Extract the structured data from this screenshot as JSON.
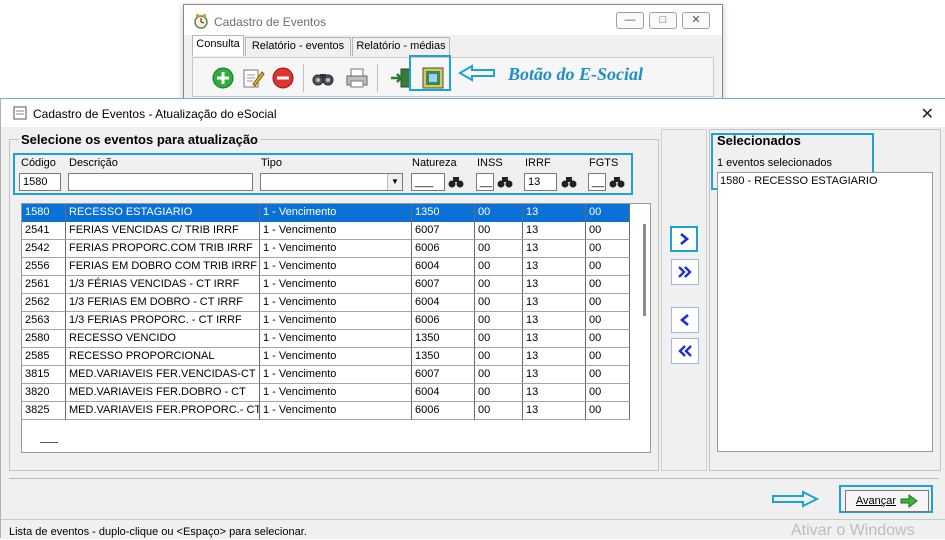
{
  "background_window": {
    "title": "Cadastro de Eventos",
    "tabs": [
      "Consulta",
      "Relatório - eventos",
      "Relatório - médias"
    ],
    "toolbar_icons": [
      "add-icon",
      "edit-icon",
      "delete-icon",
      "binoculars-icon",
      "print-icon",
      "exit-icon",
      "esocial-icon"
    ],
    "annotation": "Botão do E-Social"
  },
  "dialog": {
    "title": "Cadastro de Eventos - Atualização do eSocial",
    "left_group_title": "Selecione os eventos para atualização",
    "filters": {
      "codigo_label": "Código",
      "codigo_value": "1580",
      "descricao_label": "Descrição",
      "descricao_value": "",
      "tipo_label": "Tipo",
      "tipo_value": "",
      "natureza_label": "Natureza",
      "natureza_value": "___",
      "inss_label": "INSS",
      "inss_value": "__",
      "irrf_label": "IRRF",
      "irrf_value": "13",
      "fgts_label": "FGTS",
      "fgts_value": "__"
    },
    "rows": [
      {
        "codigo": "1580",
        "descricao": "RECESSO ESTAGIARIO",
        "tipo": "1 - Vencimento",
        "natureza": "1350",
        "inss": "00",
        "irrf": "13",
        "fgts": "00"
      },
      {
        "codigo": "2541",
        "descricao": "FERIAS VENCIDAS C/ TRIB IRRF",
        "tipo": "1 - Vencimento",
        "natureza": "6007",
        "inss": "00",
        "irrf": "13",
        "fgts": "00"
      },
      {
        "codigo": "2542",
        "descricao": "FERIAS PROPORC.COM TRIB IRRF",
        "tipo": "1 - Vencimento",
        "natureza": "6006",
        "inss": "00",
        "irrf": "13",
        "fgts": "00"
      },
      {
        "codigo": "2556",
        "descricao": "FERIAS EM DOBRO COM TRIB IRRF",
        "tipo": "1 - Vencimento",
        "natureza": "6004",
        "inss": "00",
        "irrf": "13",
        "fgts": "00"
      },
      {
        "codigo": "2561",
        "descricao": "1/3 FÉRIAS VENCIDAS - CT IRRF",
        "tipo": "1 - Vencimento",
        "natureza": "6007",
        "inss": "00",
        "irrf": "13",
        "fgts": "00"
      },
      {
        "codigo": "2562",
        "descricao": "1/3 FERIAS EM DOBRO - CT IRRF",
        "tipo": "1 - Vencimento",
        "natureza": "6004",
        "inss": "00",
        "irrf": "13",
        "fgts": "00"
      },
      {
        "codigo": "2563",
        "descricao": "1/3 FERIAS PROPORC. - CT IRRF",
        "tipo": "1 - Vencimento",
        "natureza": "6006",
        "inss": "00",
        "irrf": "13",
        "fgts": "00"
      },
      {
        "codigo": "2580",
        "descricao": "RECESSO VENCIDO",
        "tipo": "1 - Vencimento",
        "natureza": "1350",
        "inss": "00",
        "irrf": "13",
        "fgts": "00"
      },
      {
        "codigo": "2585",
        "descricao": "RECESSO PROPORCIONAL",
        "tipo": "1 - Vencimento",
        "natureza": "1350",
        "inss": "00",
        "irrf": "13",
        "fgts": "00"
      },
      {
        "codigo": "3815",
        "descricao": "MED.VARIAVEIS FER.VENCIDAS-CT",
        "tipo": "1 - Vencimento",
        "natureza": "6007",
        "inss": "00",
        "irrf": "13",
        "fgts": "00"
      },
      {
        "codigo": "3820",
        "descricao": "MED.VARIAVEIS FER.DOBRO - CT",
        "tipo": "1 - Vencimento",
        "natureza": "6004",
        "inss": "00",
        "irrf": "13",
        "fgts": "00"
      },
      {
        "codigo": "3825",
        "descricao": "MED.VARIAVEIS FER.PROPORC.- CT",
        "tipo": "1 - Vencimento",
        "natureza": "6006",
        "inss": "00",
        "irrf": "13",
        "fgts": "00"
      }
    ],
    "selected_title": "Selecionados",
    "selected_count": "1 eventos selecionados",
    "selected_items": [
      "1580 - RECESSO ESTAGIARIO"
    ],
    "advance_label": "Avançar",
    "status_text": "Lista de eventos - duplo-clique ou <Espaço> para selecionar.",
    "watermark": "Ativar o Windows"
  },
  "colors": {
    "selection": "#0a72d6",
    "annotation_blue": "#1ea2d6",
    "move_arrow": "#1b2fd8"
  }
}
